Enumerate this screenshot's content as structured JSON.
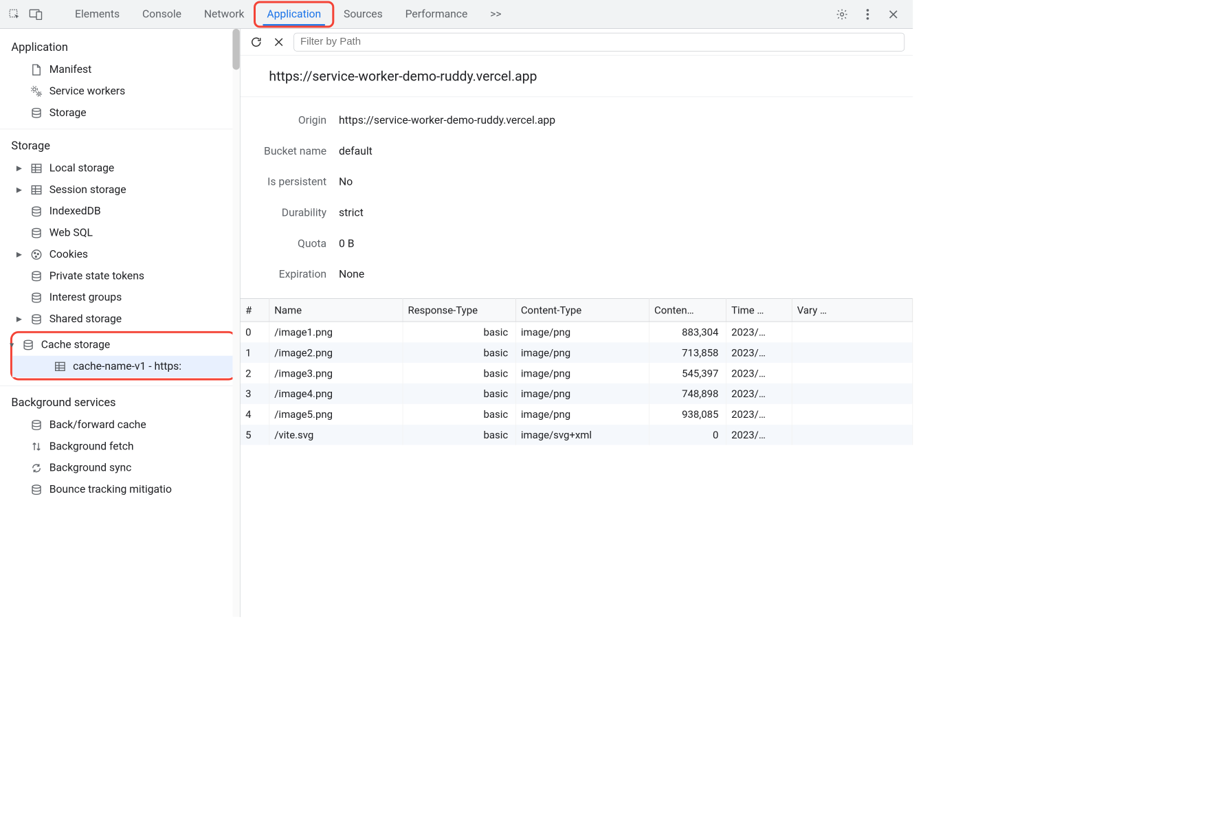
{
  "topbar": {
    "tabs": [
      "Elements",
      "Console",
      "Network",
      "Application",
      "Sources",
      "Performance"
    ],
    "active_tab": "Application",
    "more": ">>"
  },
  "sidebar": {
    "sections": {
      "application": {
        "title": "Application",
        "items": [
          {
            "label": "Manifest",
            "icon": "document"
          },
          {
            "label": "Service workers",
            "icon": "gears"
          },
          {
            "label": "Storage",
            "icon": "database"
          }
        ]
      },
      "storage": {
        "title": "Storage",
        "items": [
          {
            "label": "Local storage",
            "icon": "table",
            "expandable": true
          },
          {
            "label": "Session storage",
            "icon": "table",
            "expandable": true
          },
          {
            "label": "IndexedDB",
            "icon": "database"
          },
          {
            "label": "Web SQL",
            "icon": "database"
          },
          {
            "label": "Cookies",
            "icon": "cookie",
            "expandable": true
          },
          {
            "label": "Private state tokens",
            "icon": "database"
          },
          {
            "label": "Interest groups",
            "icon": "database"
          },
          {
            "label": "Shared storage",
            "icon": "database",
            "expandable": true
          },
          {
            "label": "Cache storage",
            "icon": "database",
            "expandable": true,
            "expanded": true,
            "children": [
              {
                "label": "cache-name-v1 - https:",
                "icon": "table",
                "selected": true
              }
            ]
          }
        ]
      },
      "background": {
        "title": "Background services",
        "items": [
          {
            "label": "Back/forward cache",
            "icon": "database"
          },
          {
            "label": "Background fetch",
            "icon": "updown"
          },
          {
            "label": "Background sync",
            "icon": "sync"
          },
          {
            "label": "Bounce tracking mitigatio",
            "icon": "database"
          }
        ]
      }
    }
  },
  "content": {
    "filter_placeholder": "Filter by Path",
    "title": "https://service-worker-demo-ruddy.vercel.app",
    "info": [
      {
        "label": "Origin",
        "value": "https://service-worker-demo-ruddy.vercel.app"
      },
      {
        "label": "Bucket name",
        "value": "default"
      },
      {
        "label": "Is persistent",
        "value": "No"
      },
      {
        "label": "Durability",
        "value": "strict"
      },
      {
        "label": "Quota",
        "value": "0 B"
      },
      {
        "label": "Expiration",
        "value": "None"
      }
    ],
    "table": {
      "columns": [
        "#",
        "Name",
        "Response-Type",
        "Content-Type",
        "Conten…",
        "Time …",
        "Vary …"
      ],
      "rows": [
        {
          "idx": "0",
          "name": "/image1.png",
          "resp": "basic",
          "ctype": "image/png",
          "clen": "883,304",
          "time": "2023/…",
          "vary": ""
        },
        {
          "idx": "1",
          "name": "/image2.png",
          "resp": "basic",
          "ctype": "image/png",
          "clen": "713,858",
          "time": "2023/…",
          "vary": ""
        },
        {
          "idx": "2",
          "name": "/image3.png",
          "resp": "basic",
          "ctype": "image/png",
          "clen": "545,397",
          "time": "2023/…",
          "vary": ""
        },
        {
          "idx": "3",
          "name": "/image4.png",
          "resp": "basic",
          "ctype": "image/png",
          "clen": "748,898",
          "time": "2023/…",
          "vary": ""
        },
        {
          "idx": "4",
          "name": "/image5.png",
          "resp": "basic",
          "ctype": "image/png",
          "clen": "938,085",
          "time": "2023/…",
          "vary": ""
        },
        {
          "idx": "5",
          "name": "/vite.svg",
          "resp": "basic",
          "ctype": "image/svg+xml",
          "clen": "0",
          "time": "2023/…",
          "vary": ""
        }
      ]
    }
  }
}
